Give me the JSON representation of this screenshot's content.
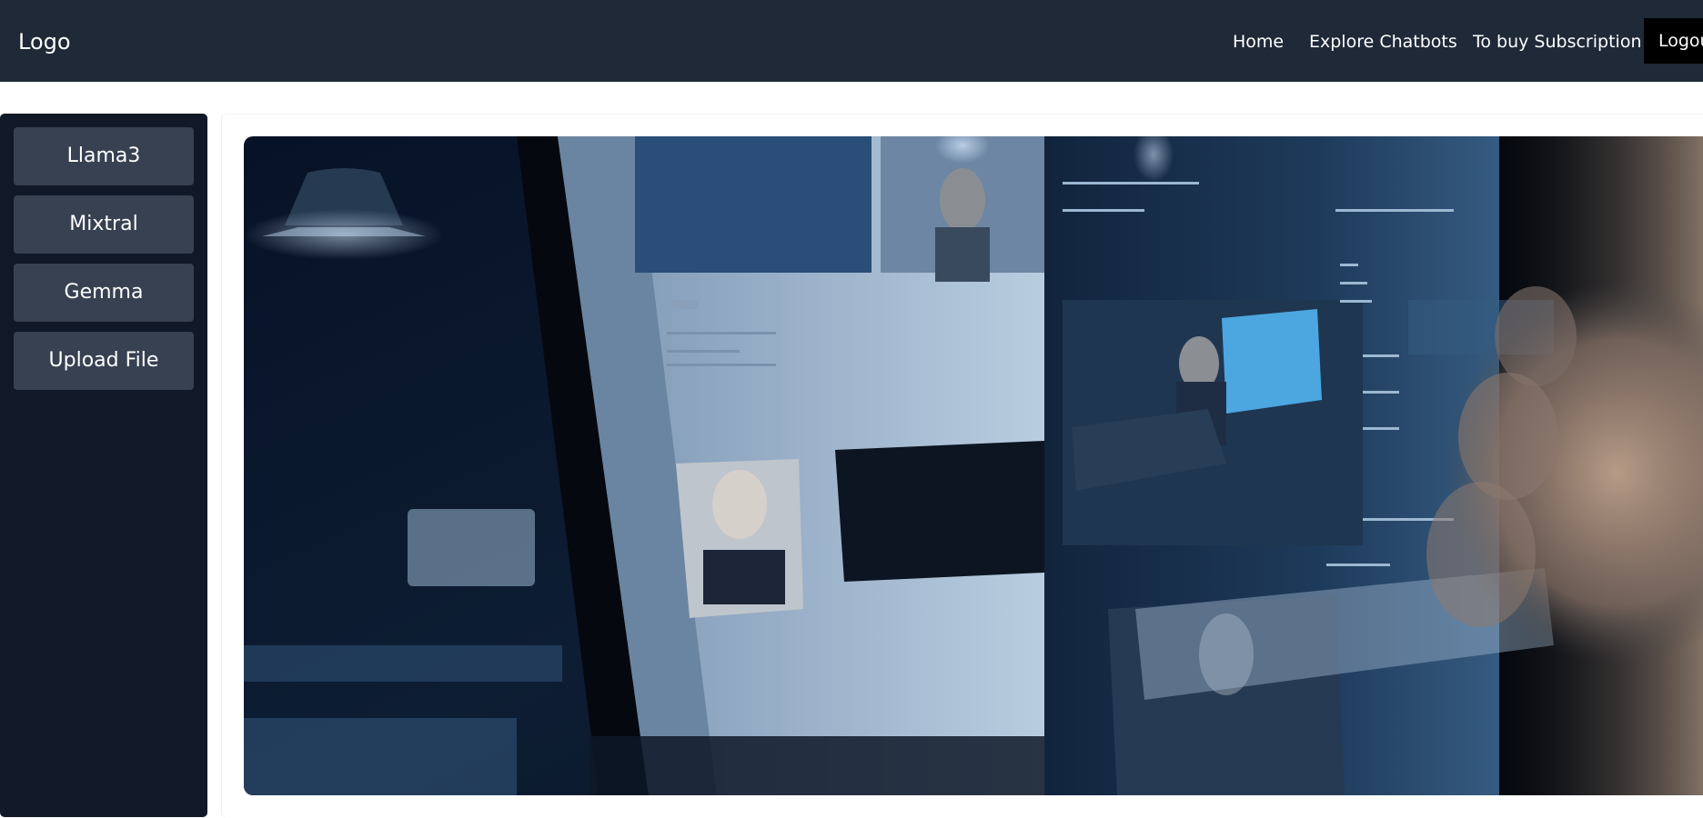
{
  "header": {
    "logo": "Logo",
    "nav": {
      "home": "Home",
      "explore": "Explore Chatbots",
      "subscribe": "To buy Subscription",
      "logout": "Logout"
    }
  },
  "sidebar": {
    "items": [
      {
        "label": "Llama3"
      },
      {
        "label": "Mixtral"
      },
      {
        "label": "Gemma"
      },
      {
        "label": "Upload File"
      }
    ]
  },
  "main": {
    "hero_image": "hero-image"
  },
  "colors": {
    "header_bg": "#1f2937",
    "sidebar_bg": "#111827",
    "sidebar_button_bg": "#374151",
    "logout_bg": "#000000"
  }
}
